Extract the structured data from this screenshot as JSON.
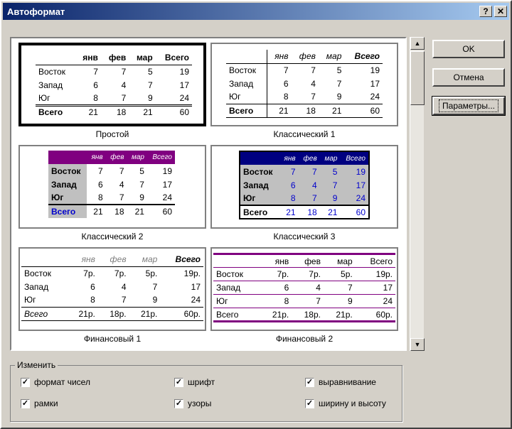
{
  "window": {
    "title": "Автоформат",
    "help_glyph": "?",
    "close_glyph": "✕"
  },
  "buttons": {
    "ok": "OK",
    "cancel": "Отмена",
    "params": "Параметры..."
  },
  "header": [
    "",
    "янв",
    "фев",
    "мар",
    "Всего"
  ],
  "rows": [
    [
      "Восток",
      "7",
      "7",
      "5",
      "19"
    ],
    [
      "Запад",
      "6",
      "4",
      "7",
      "17"
    ],
    [
      "Юг",
      "8",
      "7",
      "9",
      "24"
    ],
    [
      "Всего",
      "21",
      "18",
      "21",
      "60"
    ]
  ],
  "fin_rows": [
    [
      "Восток",
      "7р.",
      "7р.",
      "5р.",
      "19р."
    ],
    [
      "Запад",
      "6",
      "4",
      "7",
      "17"
    ],
    [
      "Юг",
      "8",
      "7",
      "9",
      "24"
    ],
    [
      "Всего",
      "21р.",
      "18р.",
      "21р.",
      "60р."
    ]
  ],
  "formats": [
    "Простой",
    "Классический 1",
    "Классический 2",
    "Классический 3",
    "Финансовый 1",
    "Финансовый 2"
  ],
  "group": {
    "title": "Изменить",
    "options": [
      {
        "label": "формат чисел",
        "checked": true
      },
      {
        "label": "шрифт",
        "checked": true
      },
      {
        "label": "выравнивание",
        "checked": true
      },
      {
        "label": "рамки",
        "checked": true
      },
      {
        "label": "узоры",
        "checked": true
      },
      {
        "label": "ширину и высоту",
        "checked": true
      }
    ]
  },
  "colors": {
    "purple": "#800080",
    "navy": "#000080",
    "gray": "#c0c0c0",
    "blue_text": "#0000cc"
  }
}
